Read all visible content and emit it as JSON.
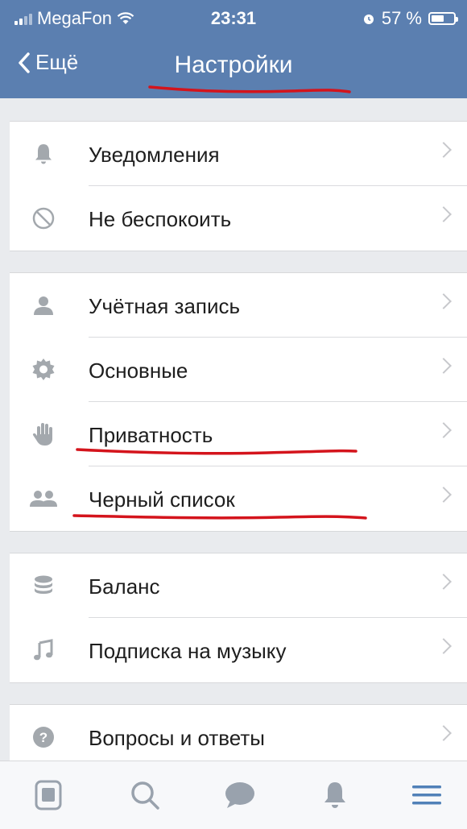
{
  "status_bar": {
    "carrier": "MegaFon",
    "time": "23:31",
    "battery_percent": "57 %",
    "battery_level": 0.57
  },
  "nav": {
    "back_label": "Ещё",
    "title": "Настройки"
  },
  "groups": [
    [
      {
        "label": "Уведомления",
        "icon": "bell-icon"
      },
      {
        "label": "Не беспокоить",
        "icon": "do-not-disturb-icon"
      }
    ],
    [
      {
        "label": "Учётная запись",
        "icon": "user-icon"
      },
      {
        "label": "Основные",
        "icon": "gear-icon"
      },
      {
        "label": "Приватность",
        "icon": "hand-icon"
      },
      {
        "label": "Черный список",
        "icon": "users-icon"
      }
    ],
    [
      {
        "label": "Баланс",
        "icon": "coins-icon"
      },
      {
        "label": "Подписка на музыку",
        "icon": "music-note-icon"
      }
    ],
    [
      {
        "label": "Вопросы и ответы",
        "icon": "question-icon"
      }
    ]
  ],
  "tab_bar": {
    "items": [
      "news-icon",
      "search-icon",
      "messages-icon",
      "notifications-icon",
      "menu-icon"
    ],
    "active": "menu-icon"
  },
  "colors": {
    "header": "#5b7fb0",
    "active_tab": "#5181b8",
    "annotation_red": "#d4141c"
  }
}
